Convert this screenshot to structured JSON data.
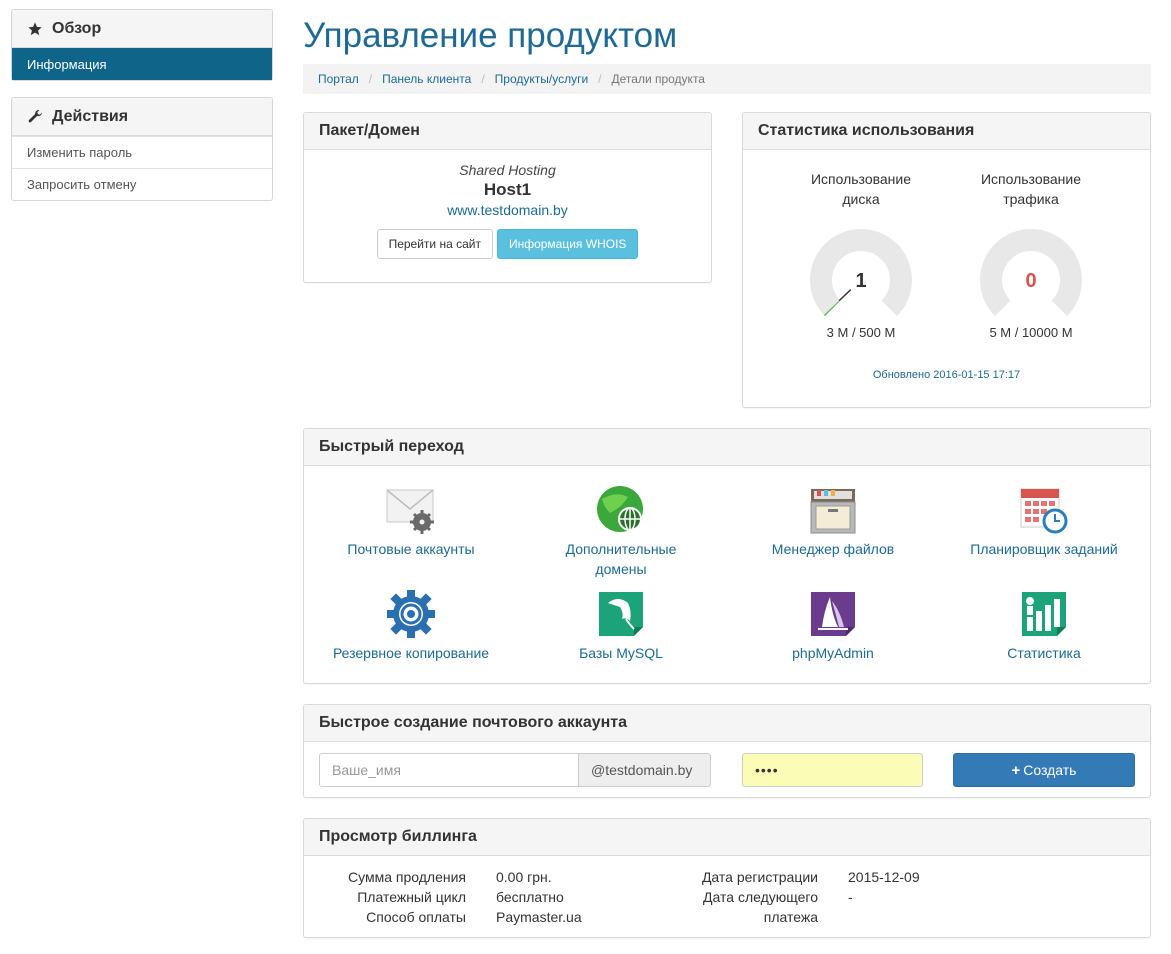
{
  "sidebar": {
    "overview": {
      "title": "Обзор",
      "icon": "star-icon",
      "items": [
        {
          "label": "Информация",
          "active": true
        }
      ]
    },
    "actions": {
      "title": "Действия",
      "icon": "wrench-icon",
      "items": [
        {
          "label": "Изменить пароль"
        },
        {
          "label": "Запросить отмену"
        }
      ]
    }
  },
  "page": {
    "title": "Управление продуктом"
  },
  "breadcrumb": [
    "Портал",
    "Панель клиента",
    "Продукты/услуги",
    "Детали продукта"
  ],
  "package": {
    "heading": "Пакет/Домен",
    "type": "Shared Hosting",
    "name": "Host1",
    "domain": "www.testdomain.by",
    "visit_button": "Перейти на сайт",
    "whois_button": "Информация WHOIS"
  },
  "usage": {
    "heading": "Статистика использования",
    "disk": {
      "title_line1": "Использование",
      "title_line2": "диска",
      "value": "1",
      "limit": "3 M / 500 M",
      "fraction": 0.006
    },
    "traffic": {
      "title_line1": "Использование",
      "title_line2": "трафика",
      "value": "0",
      "limit": "5 M / 10000 M",
      "fraction": 0.0005
    },
    "updated": "Обновлено 2016-01-15 17:17",
    "colors": {
      "gauge_bg": "#e8e8e8",
      "disk_value": "#333333",
      "traffic_value": "#d9534f"
    }
  },
  "quick_jump": {
    "heading": "Быстрый переход",
    "items": [
      {
        "label_line1": "Почтовые аккаунты",
        "label_line2": "",
        "icon": "mail-settings-icon"
      },
      {
        "label_line1": "Дополнительные",
        "label_line2": "домены",
        "icon": "globe-icon"
      },
      {
        "label_line1": "Менеджер файлов",
        "label_line2": "",
        "icon": "file-cabinet-icon"
      },
      {
        "label_line1": "Планировщик заданий",
        "label_line2": "",
        "icon": "calendar-clock-icon"
      },
      {
        "label_line1": "Резервное копирование",
        "label_line2": "",
        "icon": "backup-gear-icon"
      },
      {
        "label_line1": "Базы MySQL",
        "label_line2": "",
        "icon": "mysql-dolphin-icon"
      },
      {
        "label_line1": "phpMyAdmin",
        "label_line2": "",
        "icon": "phpmyadmin-sail-icon"
      },
      {
        "label_line1": "Статистика",
        "label_line2": "",
        "icon": "statistics-chart-icon"
      }
    ]
  },
  "email_create": {
    "heading": "Быстрое создание почтового аккаунта",
    "username_placeholder": "Ваше_имя",
    "domain_addon": "@testdomain.by",
    "password_value": "••••",
    "create_button": "Создать"
  },
  "billing": {
    "heading": "Просмотр биллинга",
    "left": [
      {
        "label": "Сумма продления",
        "value": "0.00 грн."
      },
      {
        "label": "Платежный цикл",
        "value": "бесплатно"
      },
      {
        "label": "Способ оплаты",
        "value": "Paymaster.ua"
      }
    ],
    "right": [
      {
        "label": "Дата регистрации",
        "value": "2015-12-09"
      },
      {
        "label_line1": "Дата следующего",
        "label_line2": "платежа",
        "value": "-"
      }
    ]
  }
}
